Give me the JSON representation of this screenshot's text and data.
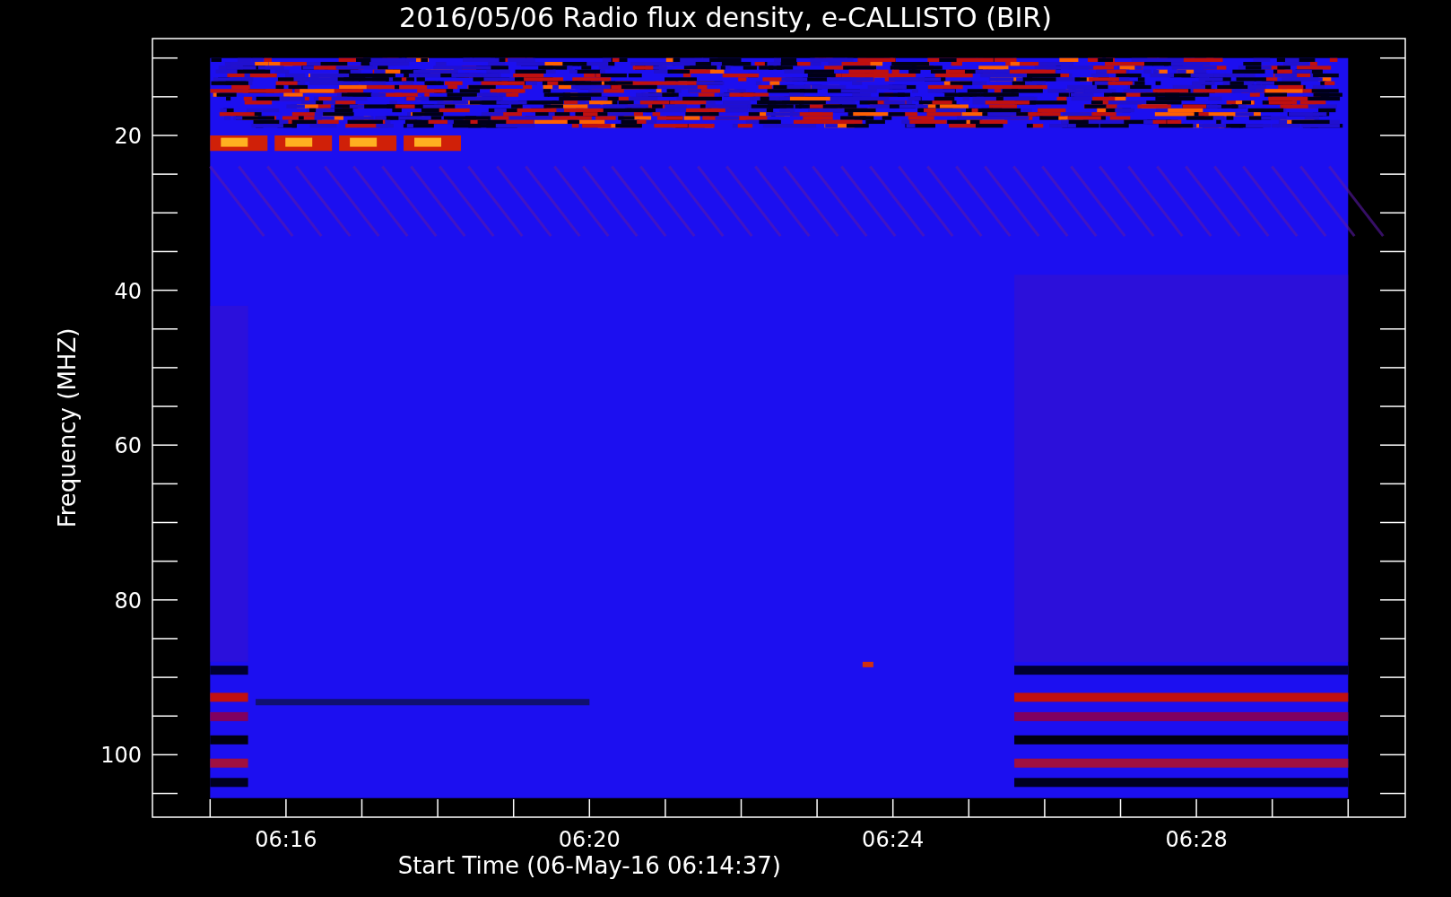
{
  "title": "2016/05/06  Radio flux density, e-CALLISTO (BIR)",
  "y_axis": {
    "label": "Frequency (MHZ)",
    "ticks": [
      "20",
      "40",
      "60",
      "80",
      "100"
    ]
  },
  "x_axis": {
    "label": "Start Time (06-May-16 06:14:37)",
    "ticks": [
      "06:16",
      "06:20",
      "06:24",
      "06:28"
    ]
  }
}
